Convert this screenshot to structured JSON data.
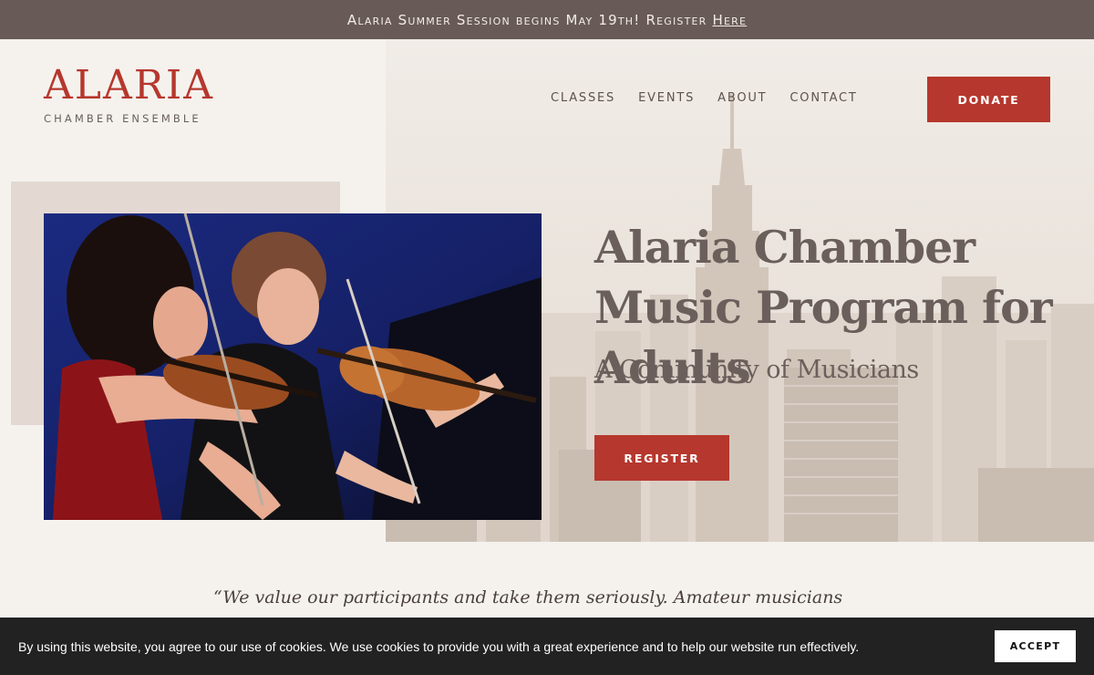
{
  "announcement": {
    "text": "Alaria Summer Session begins May 19th! Register",
    "link_label": "Here"
  },
  "logo": {
    "name": "ALARIA",
    "subtitle": "CHAMBER ENSEMBLE"
  },
  "nav": {
    "items": [
      {
        "label": "CLASSES"
      },
      {
        "label": "EVENTS"
      },
      {
        "label": "ABOUT"
      },
      {
        "label": "CONTACT"
      }
    ],
    "donate_label": "DONATE"
  },
  "hero": {
    "title": "Alaria Chamber Music Program for Adults",
    "subtitle": "A Community of Musicians",
    "register_label": "REGISTER",
    "photo": "two-violinists-performing-photo",
    "background": "city-skyline-photo"
  },
  "quote": {
    "text": "“We value our participants and take them seriously. Amateur musicians engage in music"
  },
  "cookie_banner": {
    "message": "By using this website, you agree to our use of cookies. We use cookies to provide you with a great experience and to help our website run effectively.",
    "accept_label": "ACCEPT"
  },
  "colors": {
    "accent": "#b6372d",
    "announcement_bg": "#675a57",
    "text": "#6b5f5c",
    "page_bg": "#f5f2ee",
    "cookie_bg": "#222222"
  }
}
